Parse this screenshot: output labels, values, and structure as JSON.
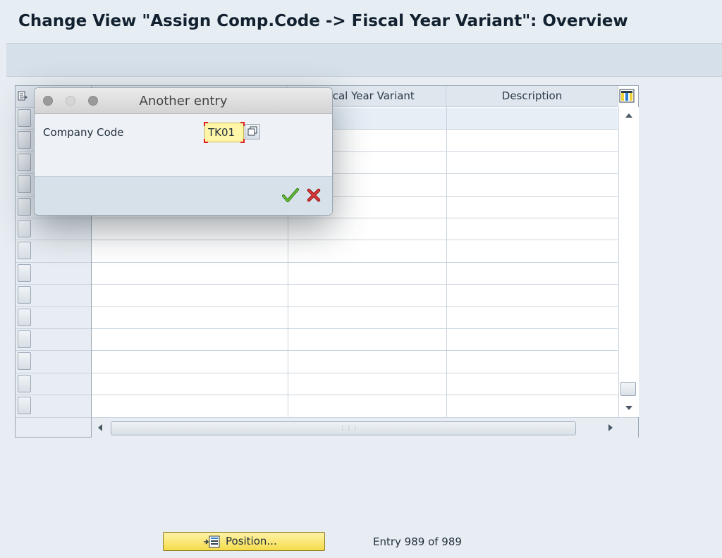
{
  "header": {
    "title": "Change View \"Assign Comp.Code -> Fiscal Year Variant\": Overview"
  },
  "table": {
    "columns": [
      {
        "label": ""
      },
      {
        "label": "Fiscal Year Variant"
      },
      {
        "label": "Description"
      }
    ],
    "visible_rows": 14
  },
  "dialog": {
    "title": "Another entry",
    "field_label": "Company Code",
    "company_code_value": "TK01"
  },
  "footer": {
    "position_button_label": "Position...",
    "entry_counter": "Entry 989 of 989"
  },
  "icons": {
    "select_all": "select-all-icon",
    "column_settings": "column-settings-icon",
    "confirm": "green-checkmark-icon",
    "cancel": "red-x-icon",
    "position": "position-icon",
    "f4_help": "value-help-icon"
  },
  "colors": {
    "background": "#e7edf2",
    "input_highlight": "#fff6a8",
    "position_button": "#f5dc4a",
    "confirm_green": "#3c9a1f",
    "cancel_red": "#cc1f1f"
  }
}
